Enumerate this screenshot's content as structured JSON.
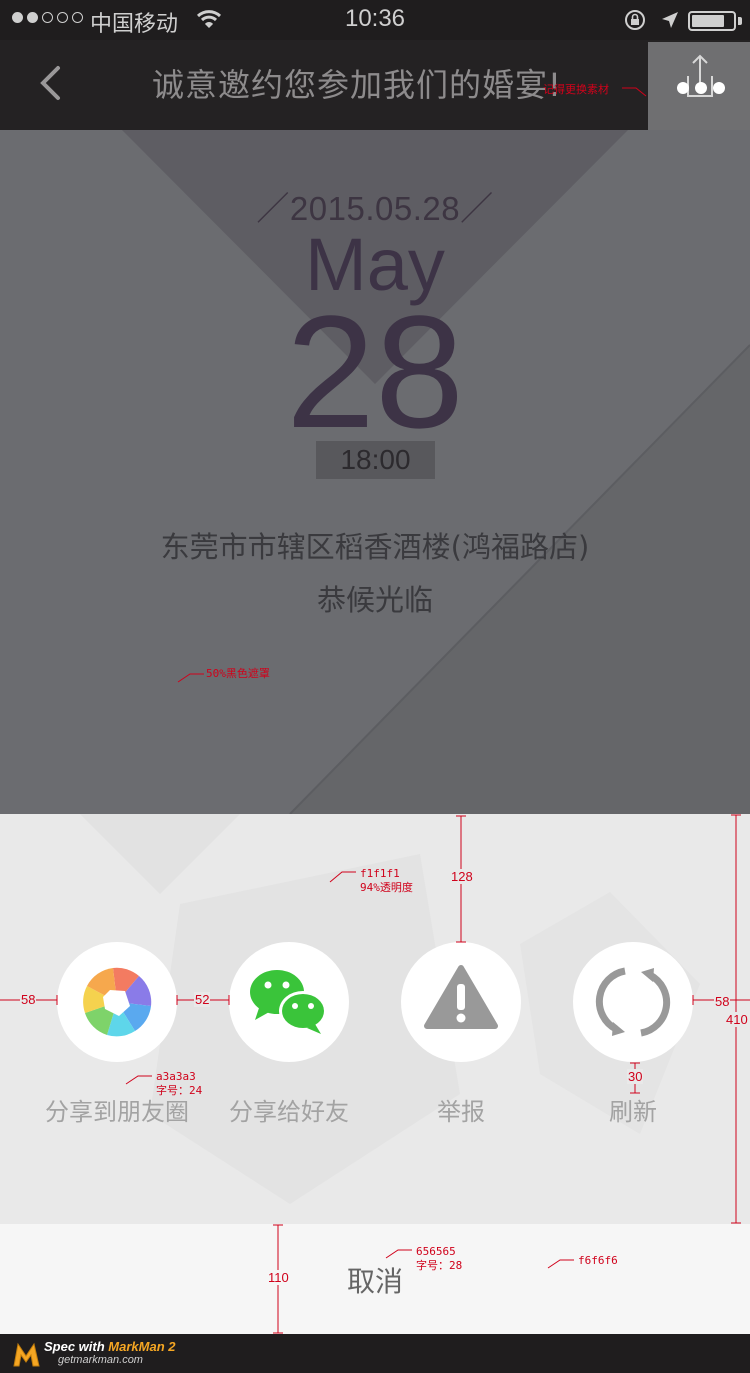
{
  "status_bar": {
    "carrier": "中国移动",
    "time": "10:36",
    "signal_bars": 2,
    "signal_total": 5,
    "battery_level": 0.8
  },
  "nav": {
    "title": "诚意邀约您参加我们的婚宴!",
    "back_icon": "chevron-left-icon",
    "share_icon": "share-more-icon"
  },
  "invitation": {
    "date": "／2015.05.28／",
    "month": "May",
    "day": "28",
    "time": "18:00",
    "address": "东莞市市辖区稻香酒楼(鸿福路店)",
    "greeting": "恭候光临"
  },
  "share_sheet": {
    "items": [
      {
        "label": "分享到朋友圈",
        "icon": "moments-aperture-icon"
      },
      {
        "label": "分享给好友",
        "icon": "wechat-icon"
      },
      {
        "label": "举报",
        "icon": "warning-icon"
      },
      {
        "label": "刷新",
        "icon": "refresh-icon"
      }
    ],
    "cancel_label": "取消"
  },
  "colors": {
    "sheet_bg": "#e9e9e9",
    "cancel_bg": "#f6f6f6",
    "label": "#a3a3a3",
    "cancel_text": "#656565",
    "annotation": "#d0021b",
    "wechat_green": "#3ac43a"
  },
  "annotations": {
    "share_note": "记得更换素材",
    "overlay_note": "50%黑色遮罩",
    "sheet_color": "f1f1f1",
    "sheet_opacity": "94%透明度",
    "label_color": "a3a3a3",
    "label_size": "字号：24",
    "cancel_color": "656565",
    "cancel_size": "字号：28",
    "cancel_bg": "f6f6f6",
    "dim_top": "128",
    "dim_left": "58",
    "dim_gap": "52",
    "dim_right": "58",
    "dim_height": "410",
    "dim_label_gap": "30",
    "dim_cancel": "110"
  },
  "footer": {
    "spec_prefix": "Spec with ",
    "brand": "MarkMan 2",
    "url": "getmarkman.com"
  }
}
